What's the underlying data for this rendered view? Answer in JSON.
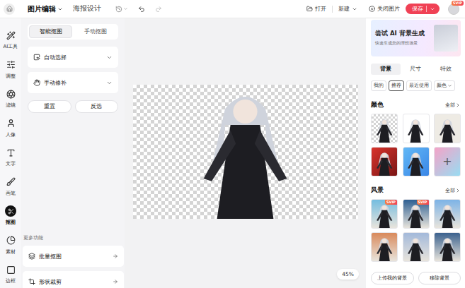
{
  "topbar": {
    "menus": [
      {
        "label": "图片编辑",
        "selected": true,
        "dropdown": true
      },
      {
        "label": "海报设计",
        "selected": false,
        "dropdown": false
      }
    ],
    "open": "打开",
    "new": "新建",
    "close": "关闭图片",
    "save": "保存",
    "avatar_badge": "SVIP"
  },
  "tools": [
    {
      "label": "AI工具",
      "selected": false
    },
    {
      "label": "调整",
      "selected": false
    },
    {
      "label": "滤镜",
      "selected": false
    },
    {
      "label": "人像",
      "selected": false
    },
    {
      "label": "文字",
      "selected": false
    },
    {
      "label": "画笔",
      "selected": false
    },
    {
      "label": "抠图",
      "selected": true
    },
    {
      "label": "素材",
      "selected": false
    },
    {
      "label": "边框",
      "selected": false
    }
  ],
  "cutout": {
    "tabs": [
      {
        "label": "智能抠图",
        "selected": true
      },
      {
        "label": "手动抠图",
        "selected": false
      }
    ],
    "sections": [
      {
        "label": "自动选择",
        "expanded": false
      },
      {
        "label": "手动修补",
        "expanded": false
      }
    ],
    "actions": [
      "重置",
      "反选"
    ],
    "more_title": "更多功能",
    "more": [
      "批量抠图",
      "形状裁剪"
    ]
  },
  "canvas": {
    "zoom": "45%"
  },
  "background_panel": {
    "banner": {
      "title": "尝试 AI 背景生成",
      "subtitle": "快速生成您的理想场景"
    },
    "tabs": [
      {
        "label": "背景",
        "selected": true
      },
      {
        "label": "尺寸",
        "selected": false
      },
      {
        "label": "特效",
        "selected": false
      }
    ],
    "filters": [
      {
        "label": "我的",
        "selected": false,
        "dropdown": false
      },
      {
        "label": "推荐",
        "selected": true,
        "dropdown": false
      },
      {
        "label": "最近使用",
        "selected": false,
        "dropdown": false
      },
      {
        "label": "颜色",
        "selected": false,
        "dropdown": true
      }
    ],
    "colors": {
      "title": "颜色",
      "more": "全部",
      "items": [
        {
          "kind": "transparent"
        },
        {
          "kind": "solid",
          "color": "#ffffff"
        },
        {
          "kind": "solid",
          "color": "#eeebe4"
        },
        {
          "kind": "gradient",
          "color": "#d9342c",
          "color2": "#7a1515"
        },
        {
          "kind": "gradient",
          "color": "#62b8f6",
          "color2": "#3a86e6"
        },
        {
          "kind": "add",
          "label": "+",
          "color": "#f5a3c7",
          "color2": "#98dcf2"
        }
      ]
    },
    "scenery": {
      "title": "风景",
      "more": "全部",
      "items": [
        {
          "badge": "SVIP",
          "color": "#74bde0"
        },
        {
          "badge": "SVIP",
          "color": "#2e5f92"
        },
        {
          "color": "#7db3e6"
        },
        {
          "color": "#d98a5c"
        },
        {
          "color": "#a3b9da"
        },
        {
          "color": "#3c628e"
        }
      ]
    },
    "buttons": [
      "上传我的背景",
      "移除背景"
    ]
  }
}
